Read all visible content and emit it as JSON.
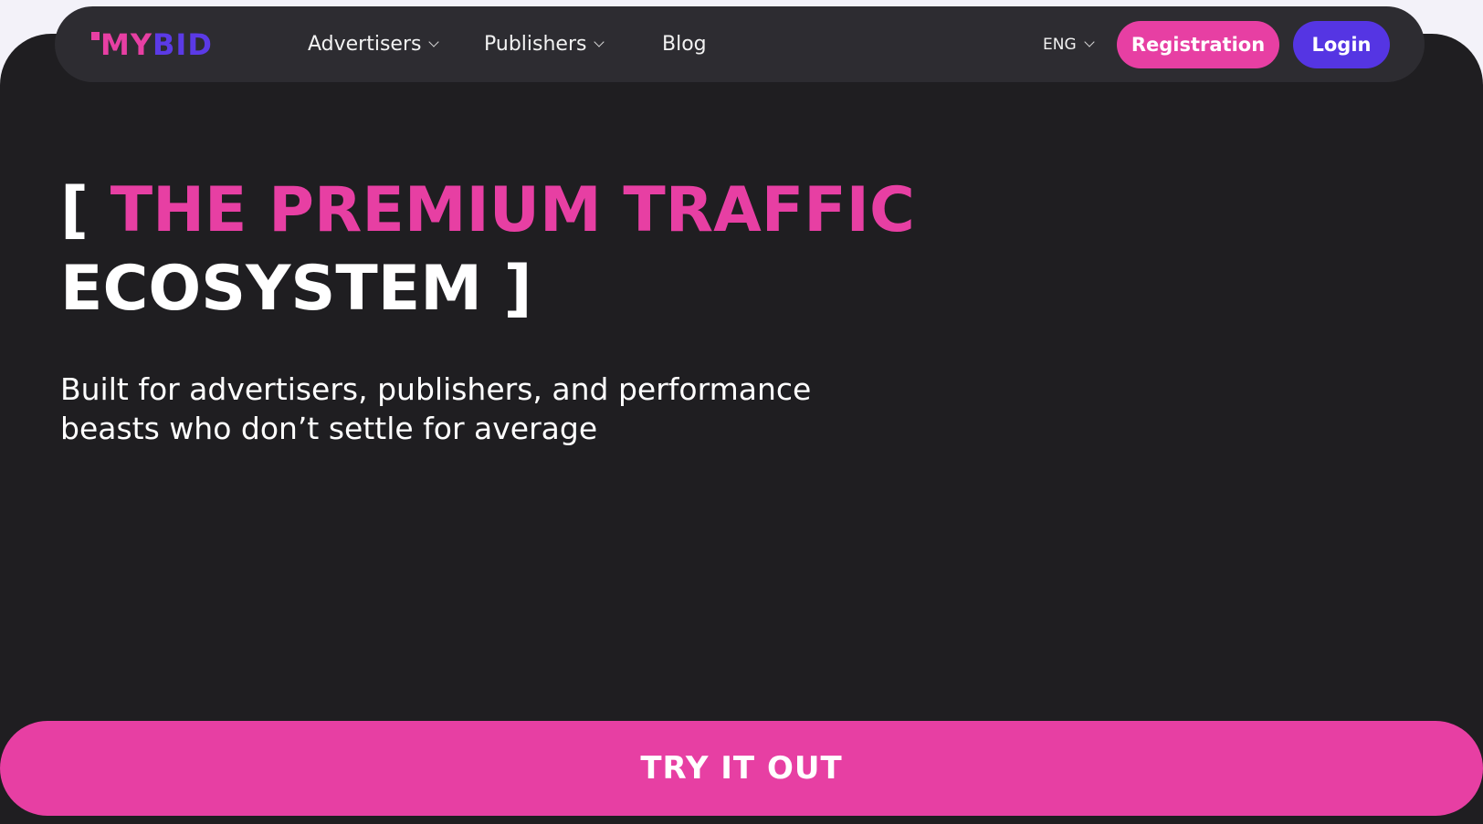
{
  "navbar": {
    "logo_tick": "'",
    "logo_part1": "MY",
    "logo_part2": "BID",
    "items": [
      {
        "label": "Advertisers"
      },
      {
        "label": "Publishers"
      },
      {
        "label": "Blog"
      }
    ],
    "language": "ENG",
    "registration_label": "Registration",
    "login_label": "Login"
  },
  "hero": {
    "headline_open_bracket": "[",
    "headline_highlight": "THE PREMIUM TRAFFIC",
    "headline_rest": "ECOSYSTEM ]",
    "subtitle_line1": "Built for advertisers, publishers, and performance",
    "subtitle_line2": "beasts who don’t settle for average"
  },
  "cta": {
    "label": "TRY IT OUT"
  },
  "colors": {
    "accent_pink": "#e73fa3",
    "accent_purple": "#5535e3",
    "background_dark": "#1f1e21",
    "navbar_bg": "#2d2c31"
  },
  "icons": {
    "dropdown": "chevron-down-icon"
  }
}
